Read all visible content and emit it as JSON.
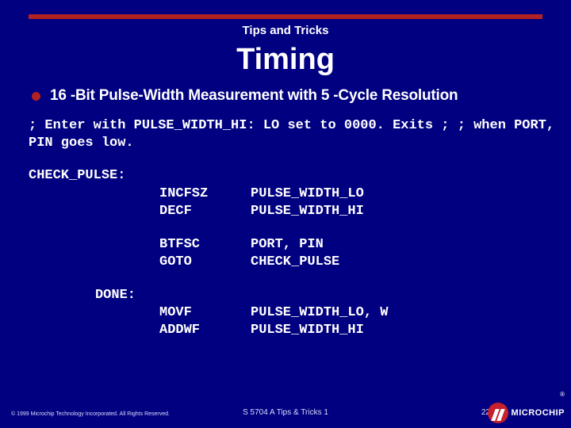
{
  "header": {
    "kicker": "Tips and Tricks",
    "title": "Timing"
  },
  "bullet": {
    "text": "16 -Bit Pulse-Width Measurement with 5 -Cycle Resolution"
  },
  "comment": "; Enter with PULSE_WIDTH_HI: LO set to 0000.  Exits ; ; when PORT, PIN goes low.",
  "code": {
    "label1": "CHECK_PULSE:",
    "block1": [
      {
        "op": "INCFSZ",
        "arg": "PULSE_WIDTH_LO"
      },
      {
        "op": "DECF",
        "arg": "PULSE_WIDTH_HI"
      }
    ],
    "block2": [
      {
        "op": "BTFSC",
        "arg": "PORT, PIN"
      },
      {
        "op": "GOTO",
        "arg": "CHECK_PULSE"
      }
    ],
    "label2": "DONE:",
    "block3": [
      {
        "op": "MOVF",
        "arg": "PULSE_WIDTH_LO, W"
      },
      {
        "op": "ADDWF",
        "arg": "PULSE_WIDTH_HI"
      }
    ]
  },
  "footer": {
    "copyright": "© 1999 Microchip Technology Incorporated. All Rights Reserved.",
    "mid": "S 5704 A Tips & Tricks 1",
    "page": "22",
    "brand": "MICROCHIP",
    "reg": "®"
  }
}
